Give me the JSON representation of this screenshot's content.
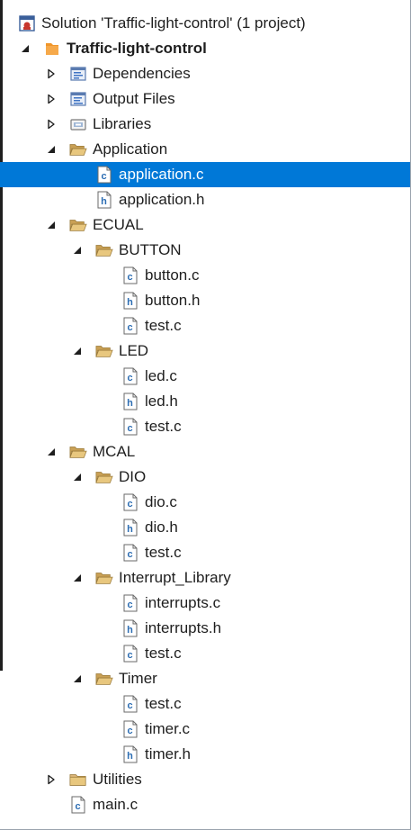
{
  "tree": [
    {
      "label": "Solution 'Traffic-light-control' (1 project)",
      "icon": "solution-icon",
      "depth": 0,
      "expander": "none",
      "bold": false
    },
    {
      "label": "Traffic-light-control",
      "icon": "project-icon",
      "depth": 0,
      "expander": "expanded",
      "bold": true
    },
    {
      "label": "Dependencies",
      "icon": "dependencies-icon",
      "depth": 1,
      "expander": "collapsed"
    },
    {
      "label": "Output Files",
      "icon": "output-files-icon",
      "depth": 1,
      "expander": "collapsed"
    },
    {
      "label": "Libraries",
      "icon": "libraries-icon",
      "depth": 1,
      "expander": "collapsed"
    },
    {
      "label": "Application",
      "icon": "folder-open-icon",
      "depth": 1,
      "expander": "expanded"
    },
    {
      "label": "application.c",
      "icon": "c-file-icon",
      "depth": 2,
      "expander": "none",
      "selected": true
    },
    {
      "label": "application.h",
      "icon": "h-file-icon",
      "depth": 2,
      "expander": "none"
    },
    {
      "label": "ECUAL",
      "icon": "folder-open-icon",
      "depth": 1,
      "expander": "expanded"
    },
    {
      "label": "BUTTON",
      "icon": "folder-open-icon",
      "depth": 2,
      "expander": "expanded"
    },
    {
      "label": "button.c",
      "icon": "c-file-icon",
      "depth": 3,
      "expander": "none"
    },
    {
      "label": "button.h",
      "icon": "h-file-icon",
      "depth": 3,
      "expander": "none"
    },
    {
      "label": "test.c",
      "icon": "c-file-icon",
      "depth": 3,
      "expander": "none"
    },
    {
      "label": "LED",
      "icon": "folder-open-icon",
      "depth": 2,
      "expander": "expanded"
    },
    {
      "label": "led.c",
      "icon": "c-file-icon",
      "depth": 3,
      "expander": "none"
    },
    {
      "label": "led.h",
      "icon": "h-file-icon",
      "depth": 3,
      "expander": "none"
    },
    {
      "label": "test.c",
      "icon": "c-file-icon",
      "depth": 3,
      "expander": "none"
    },
    {
      "label": "MCAL",
      "icon": "folder-open-icon",
      "depth": 1,
      "expander": "expanded"
    },
    {
      "label": "DIO",
      "icon": "folder-open-icon",
      "depth": 2,
      "expander": "expanded"
    },
    {
      "label": "dio.c",
      "icon": "c-file-icon",
      "depth": 3,
      "expander": "none"
    },
    {
      "label": "dio.h",
      "icon": "h-file-icon",
      "depth": 3,
      "expander": "none"
    },
    {
      "label": "test.c",
      "icon": "c-file-icon",
      "depth": 3,
      "expander": "none"
    },
    {
      "label": "Interrupt_Library",
      "icon": "folder-open-icon",
      "depth": 2,
      "expander": "expanded"
    },
    {
      "label": "interrupts.c",
      "icon": "c-file-icon",
      "depth": 3,
      "expander": "none"
    },
    {
      "label": "interrupts.h",
      "icon": "h-file-icon",
      "depth": 3,
      "expander": "none"
    },
    {
      "label": "test.c",
      "icon": "c-file-icon",
      "depth": 3,
      "expander": "none"
    },
    {
      "label": "Timer",
      "icon": "folder-open-icon",
      "depth": 2,
      "expander": "expanded"
    },
    {
      "label": "test.c",
      "icon": "c-file-icon",
      "depth": 3,
      "expander": "none"
    },
    {
      "label": "timer.c",
      "icon": "c-file-icon",
      "depth": 3,
      "expander": "none"
    },
    {
      "label": "timer.h",
      "icon": "h-file-icon",
      "depth": 3,
      "expander": "none"
    },
    {
      "label": "Utilities",
      "icon": "folder-closed-icon",
      "depth": 1,
      "expander": "collapsed"
    },
    {
      "label": "main.c",
      "icon": "c-file-icon",
      "depth": 1,
      "expander": "none"
    }
  ],
  "colors": {
    "selection": "#0078d7",
    "folder": "#dcb67a",
    "file_blue": "#2c6db3",
    "project_orange": "#f0962a"
  }
}
